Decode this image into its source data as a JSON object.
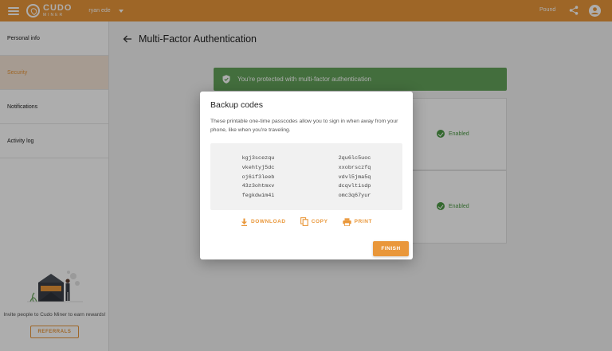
{
  "colors": {
    "accent": "#e9973a",
    "success": "#63a35a",
    "enabled_text": "#4c9a45"
  },
  "topbar": {
    "logo_top": "CUDO",
    "logo_bottom": "MINER",
    "user_name": "ryan ede",
    "currency": "Pound",
    "icons": [
      "menu-icon",
      "share-icon",
      "account-icon"
    ]
  },
  "sidebar": {
    "items": [
      {
        "label": "Personal info",
        "active": false
      },
      {
        "label": "Security",
        "active": true
      },
      {
        "label": "Notifications",
        "active": false
      },
      {
        "label": "Activity log",
        "active": false
      }
    ],
    "invite_text": "Invite people to Cudo Miner to earn rewards!",
    "referrals_label": "REFERRALS"
  },
  "main": {
    "title": "Multi-Factor Authentication",
    "banner_text": "You're protected with multi-factor authentication",
    "cards": [
      {
        "status": "Enabled"
      },
      {
        "status": "Enabled"
      }
    ]
  },
  "dialog": {
    "title": "Backup codes",
    "description": "These printable one-time passcodes allow you to sign in when away from your phone, like when you're traveling.",
    "codes_left": [
      "kgj3scezqu",
      "vkehtyj5dc",
      "oj6if3leeb",
      "43z3ohtmxv",
      "fegkdwim4i"
    ],
    "codes_right": [
      "2qu6lc5uoc",
      "xxobrsczfq",
      "vdvl5jma5q",
      "dcqvltisdp",
      "omc3q67yur"
    ],
    "download_label": "DOWNLOAD",
    "copy_label": "COPY",
    "print_label": "PRINT",
    "finish_label": "FINISH"
  }
}
